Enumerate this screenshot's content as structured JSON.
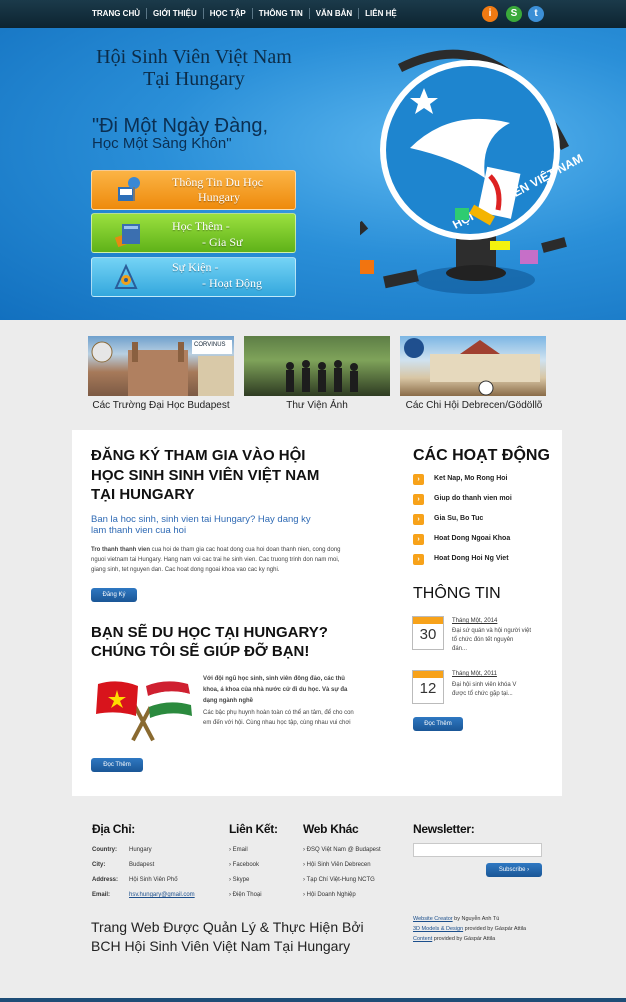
{
  "nav": {
    "items": [
      "TRANG CHỦ",
      "GIỚI THIỆU",
      "HỌC TẬP",
      "THÔNG TIN",
      "VĂN BẢN",
      "LIÊN HỆ"
    ]
  },
  "hero": {
    "title_line1": "Hội Sinh Viên Việt Nam",
    "title_line2": "Tại Hungary",
    "quote_line1": "\"Đi Một Ngày Đàng,",
    "quote_line2": "Học Một Sàng Khôn\"",
    "buttons": [
      {
        "line1": "Thông Tin Du Học",
        "line2": "Hungary",
        "color": "#f39a1e"
      },
      {
        "line1": "Học Thêm -",
        "line2": "- Gia Sư",
        "color": "#7fc72a"
      },
      {
        "line1": "Sự Kiện -",
        "line2": "- Hoạt Động",
        "color": "#45b7e8"
      }
    ],
    "logo_text": "HỘI SINH VIÊN VIỆT NAM"
  },
  "strip": {
    "captions": [
      "Các Trường Đại Học Budapest",
      "Thư Viện Ảnh",
      "Các Chi Hội Debrecen/Gödöllõ"
    ],
    "corvinus": "CORVINUS"
  },
  "register": {
    "heading_line1": "ĐĂNG KÝ THAM GIA VÀO HỘI",
    "heading_line2": "HỌC SINH SINH VIÊN VIỆT NAM",
    "heading_line3": "TẠI HUNGARY",
    "sub_line1": "Ban la hoc sinh, sinh vien tai Hungary? Hay dang ky",
    "sub_line2": "lam thanh vien cua hoi",
    "body_bold": "Tro thanh thanh vien",
    "body_line1": " cua hoi de tham gia cac hoat dong cua hoi doan thanh nien, cong dong",
    "body_line2": "nguoi vietnam tai Hungary. Hang nam voi cac trai he sinh vien. Cac truong trinh don nam moi,",
    "body_line3": "giang sinh, tet nguyen dan. Cac hoat dong ngoai khoa vao cac ky nghi.",
    "button": "Đăng Ký"
  },
  "study": {
    "heading_line1": "BẠN SẼ DU HỌC TẠI HUNGARY?",
    "heading_line2": "CHÚNG TÔI SẼ GIÚP ĐỠ BẠN!",
    "bold_line1": "Với đội ngũ học sinh, sinh viên đông đảo, các thủ",
    "bold_line2": "khoa, á khoa của nhà nước cử đi du học. Và sự đa",
    "bold_line3": "dạng ngành nghề",
    "line4": "Các bậc phụ huynh hoàn toàn có thể an tâm, để cho con",
    "line5": "em đến với hội. Cùng nhau học tập, cùng nhau vui chơi",
    "button": "Đọc Thêm"
  },
  "activities": {
    "heading": "CÁC HOẠT ĐỘNG",
    "items": [
      "Ket Nap, Mo Rong Hoi",
      "Giup do thanh vien moi",
      "Gia Su, Bo Tuc",
      "Hoat Dong Ngoai Khoa",
      "Hoat Dong Hoi Ng Viet"
    ]
  },
  "news": {
    "heading": "THÔNG TIN",
    "items": [
      {
        "date": "Tháng Một, 2014",
        "day": "30",
        "line1": "Đại sứ quán và hội người việt",
        "line2": "tổ chức đón tết nguyên",
        "line3": "đán..."
      },
      {
        "date": "Tháng Một, 2011",
        "day": "12",
        "line1": "Đại hội sinh viên khóa V",
        "line2": "được tổ chức gặp tại...",
        "line3": ""
      }
    ],
    "button": "Đọc Thêm"
  },
  "footer": {
    "address_heading": "Địa Chỉ:",
    "address": [
      {
        "k": "Country:",
        "v": "Hungary"
      },
      {
        "k": "City:",
        "v": "Budapest"
      },
      {
        "k": "Address:",
        "v": "Hội Sinh Viên Phố"
      },
      {
        "k": "Email:",
        "v": "hsv.hungary@gmail.com"
      }
    ],
    "links_heading": "Liên Kết:",
    "links": [
      "Email",
      "Facebook",
      "Skype",
      "Điện Thoại"
    ],
    "web_heading": "Web Khác",
    "web": [
      "ĐSQ Việt Nam @ Budapest",
      "Hội Sinh Viên Debrecen",
      "Tạp Chí Việt-Hung NCTG",
      "Hội Doanh Nghiệp"
    ],
    "newsletter_heading": "Newsletter:",
    "subscribe": "Subscribe",
    "tagline_line1": "Trang Web Được Quản Lý & Thực Hiện Bởi",
    "tagline_line2": "BCH Hội Sinh Viên Việt Nam Tại Hungary",
    "credits": [
      {
        "link": "Website Creator",
        "rest": " by Nguyễn Anh Tú"
      },
      {
        "link": "3D Models & Design",
        "rest": " provided by Gáspár Attila"
      },
      {
        "link": "Content",
        "rest": " provided by Gáspár Attila"
      }
    ]
  }
}
